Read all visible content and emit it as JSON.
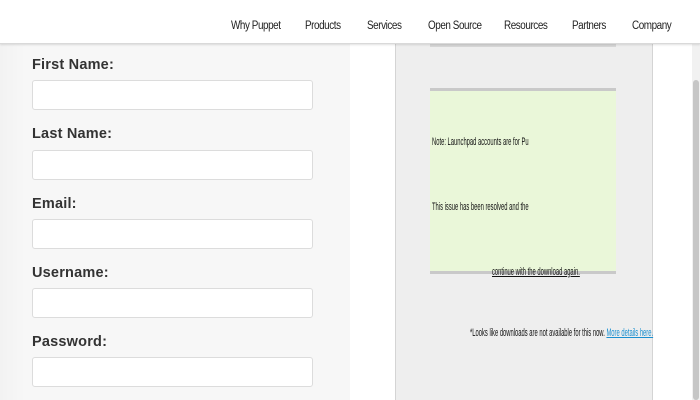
{
  "nav": {
    "items": [
      {
        "label": "Why Puppet"
      },
      {
        "label": "Products"
      },
      {
        "label": "Services"
      },
      {
        "label": "Open Source"
      },
      {
        "label": "Resources"
      },
      {
        "label": "Partners"
      },
      {
        "label": "Company"
      }
    ]
  },
  "form": {
    "first_name": {
      "label": "First Name:",
      "value": "",
      "placeholder": ""
    },
    "last_name": {
      "label": "Last Name:",
      "value": "",
      "placeholder": ""
    },
    "email": {
      "label": "Email:",
      "value": "",
      "placeholder": ""
    },
    "username": {
      "label": "Username:",
      "value": "",
      "placeholder": ""
    },
    "password": {
      "label": "Password:",
      "value": "",
      "placeholder": ""
    }
  },
  "notice": {
    "line1": "Note: Launchpad accounts are for Puppet Forge and community discussions only",
    "line2": "This issue has been resolved and the free Puppet download is working for now. You can now",
    "line3": "continue with the download again.",
    "footnote_text": "*Looks like downloads are not available for this now.",
    "footnote_link": "More details here."
  },
  "colors": {
    "notice_bg": "#eaf7d9",
    "link": "#1a8fd0"
  }
}
